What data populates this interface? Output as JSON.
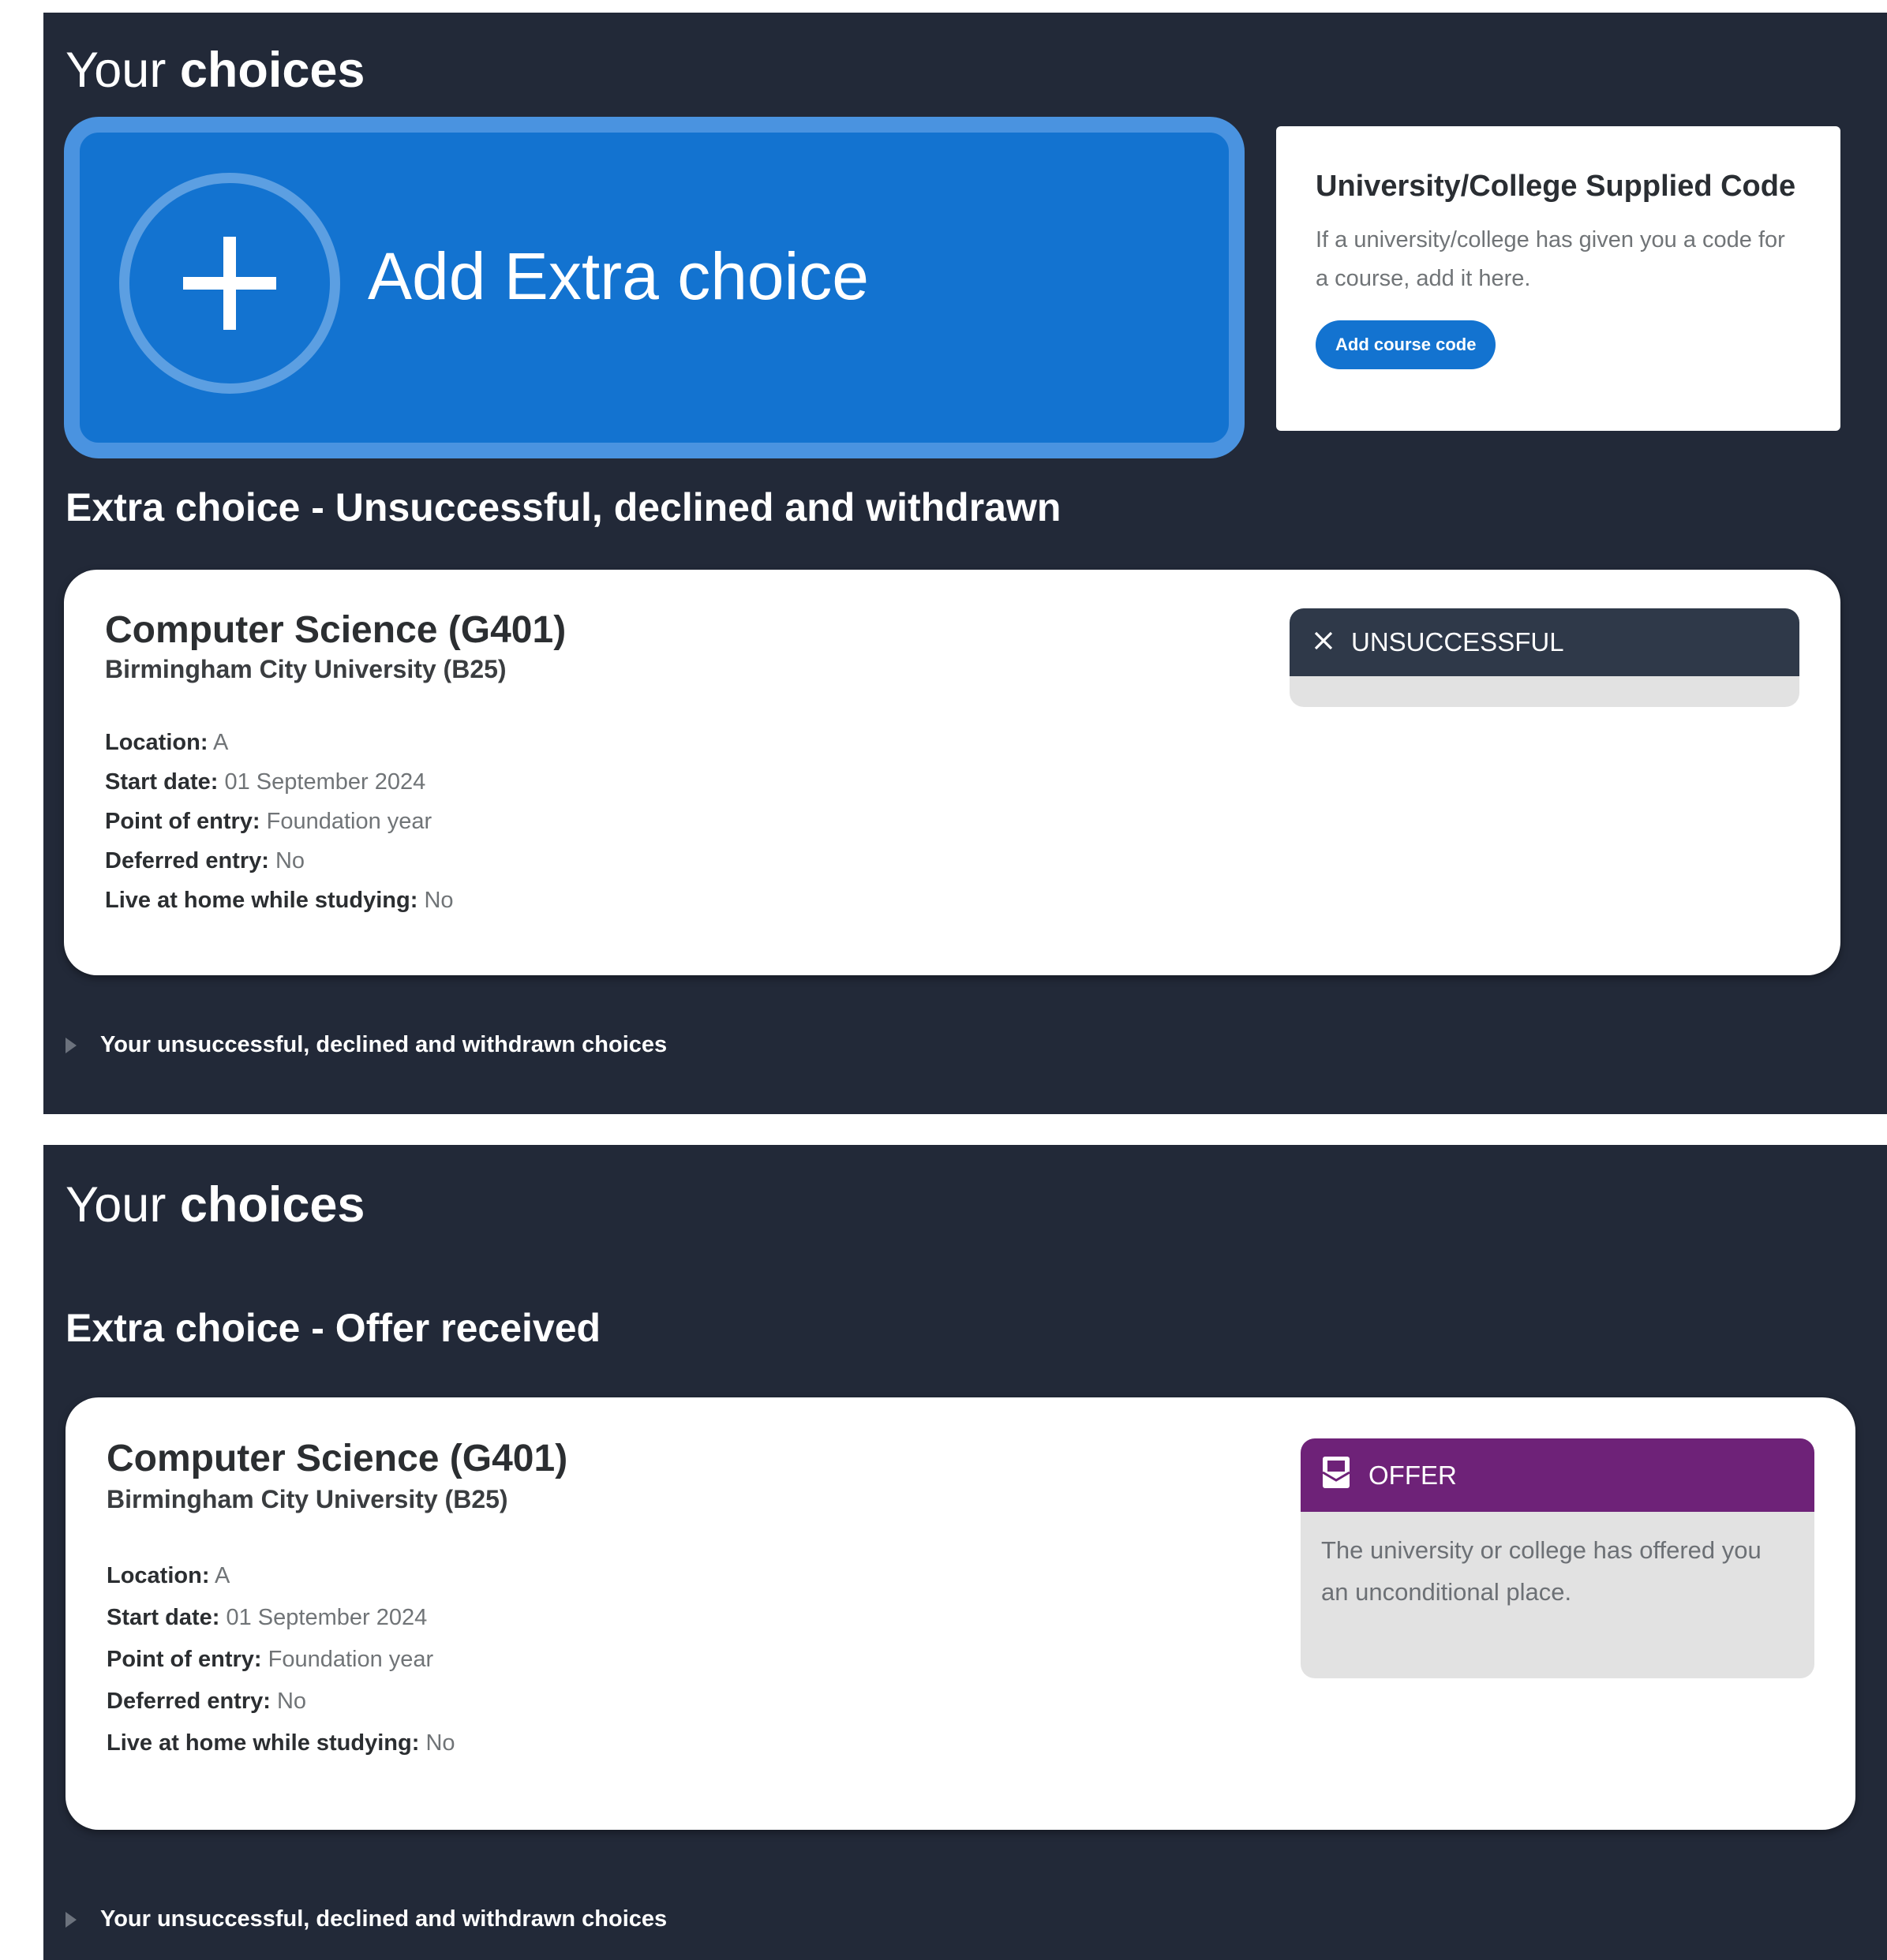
{
  "panel1": {
    "heading_light": "Your",
    "heading_bold": "choices",
    "add_extra_label": "Add Extra choice",
    "code_card": {
      "title": "University/College Supplied Code",
      "text": "If a university/college has given you a code for a course, add it here.",
      "button_label": "Add course code"
    },
    "section_title": "Extra choice - Unsuccessful, declined and withdrawn",
    "card": {
      "course": "Computer Science (G401)",
      "university": "Birmingham City University (B25)",
      "details": [
        {
          "key": "Location:",
          "value": "A"
        },
        {
          "key": "Start date:",
          "value": "01 September 2024"
        },
        {
          "key": "Point of entry:",
          "value": "Foundation year"
        },
        {
          "key": "Deferred entry:",
          "value": "No"
        },
        {
          "key": "Live at home while studying:",
          "value": "No"
        }
      ],
      "status": {
        "label": "UNSUCCESSFUL",
        "icon": "close-icon",
        "color": "#2f3949",
        "description": ""
      }
    },
    "expander_label": "Your unsuccessful, declined and withdrawn choices"
  },
  "panel2": {
    "heading_light": "Your",
    "heading_bold": "choices",
    "section_title": "Extra choice - Offer received",
    "card": {
      "course": "Computer Science (G401)",
      "university": "Birmingham City University (B25)",
      "details": [
        {
          "key": "Location:",
          "value": "A"
        },
        {
          "key": "Start date:",
          "value": "01 September 2024"
        },
        {
          "key": "Point of entry:",
          "value": "Foundation year"
        },
        {
          "key": "Deferred entry:",
          "value": "No"
        },
        {
          "key": "Live at home while studying:",
          "value": "No"
        }
      ],
      "status": {
        "label": "OFFER",
        "icon": "offer-icon",
        "color": "#6e2278",
        "description": "The university or college has offered you an unconditional place."
      }
    },
    "expander_label": "Your unsuccessful, declined and withdrawn choices"
  },
  "colors": {
    "background": "#222938",
    "primary_blue": "#1373d0",
    "unsuccessful": "#2f3949",
    "offer": "#6e2278"
  }
}
